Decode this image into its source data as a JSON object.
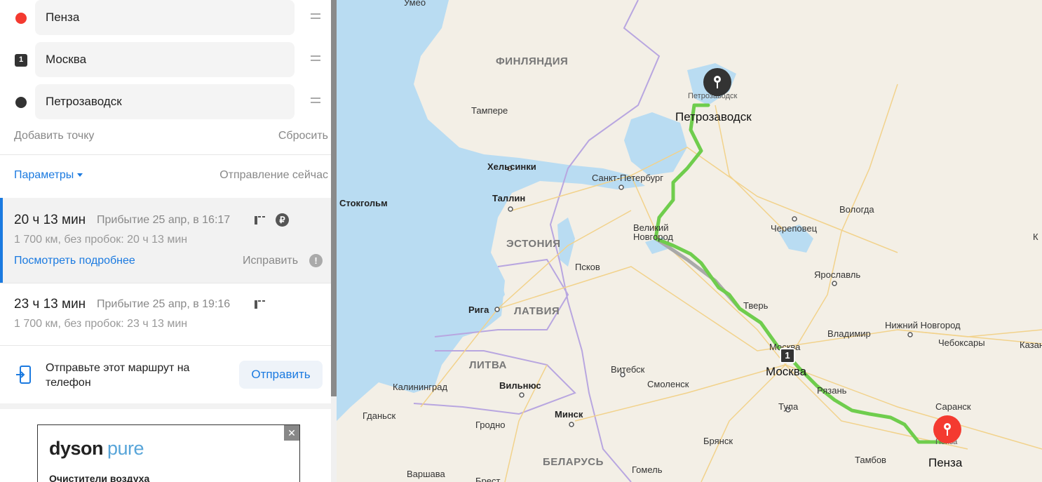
{
  "waypoints": [
    {
      "value": "Пенза",
      "marker": "red-dot"
    },
    {
      "value": "Москва",
      "marker": "number",
      "number": "1"
    },
    {
      "value": "Петрозаводск",
      "marker": "dark-dot"
    }
  ],
  "actions": {
    "add_point": "Добавить точку",
    "reset": "Сбросить"
  },
  "params": {
    "label": "Параметры",
    "departure": "Отправление сейчас"
  },
  "routes": [
    {
      "duration": "20 ч 13 мин",
      "arrival": "Прибытие 25 апр, в 16:17",
      "distance": "1 700 км, без пробок: 20 ч 13 мин",
      "details_link": "Посмотреть подробнее",
      "fix_link": "Исправить",
      "has_toll": true,
      "currency_icon": "ruble-icon"
    },
    {
      "duration": "23 ч 13 мин",
      "arrival": "Прибытие 25 апр, в 19:16",
      "distance": "1 700 км, без пробок: 23 ч 13 мин"
    }
  ],
  "send": {
    "text": "Отправьте этот маршрут на телефон",
    "button": "Отправить"
  },
  "ad": {
    "brand": "dyson",
    "brand_sub": "pure",
    "text": "Очистители воздуха",
    "close": "✕"
  },
  "map": {
    "countries": [
      "ФИНЛЯНДИЯ",
      "ЭСТОНИЯ",
      "ЛАТВИЯ",
      "ЛИТВА",
      "БЕЛАРУСЬ"
    ],
    "capitals": [
      "Хельсинки",
      "Таллин",
      "Стокгольм",
      "Рига",
      "Вильнюс",
      "Минск",
      "Варшава"
    ],
    "cities": [
      "Умео",
      "Тампере",
      "Петрозаводск",
      "Санкт-Петербург",
      "Великий Новгород",
      "Псков",
      "Вологда",
      "Череповец",
      "Ярославль",
      "Тверь",
      "Москва",
      "Владимир",
      "Нижний Новгород",
      "Чебоксары",
      "Казань",
      "Витебск",
      "Смоленск",
      "Калининград",
      "Гданьск",
      "Гродно",
      "Брест",
      "Гомель",
      "Брянск",
      "Тула",
      "Рязань",
      "Саранск",
      "Тамбов",
      "Пенза",
      "К",
      "Хельсинки"
    ],
    "route_labels": {
      "start": "Пенза",
      "via": "Москва",
      "via_number": "1",
      "end": "Петрозаводск"
    },
    "route_color": "#6fcd4d",
    "alt_route_color": "#a9a9a9",
    "water_color": "#b9dcf2"
  },
  "colors": {
    "accent": "#1b7ae0",
    "start_marker": "#f43a30",
    "end_marker": "#333333"
  }
}
